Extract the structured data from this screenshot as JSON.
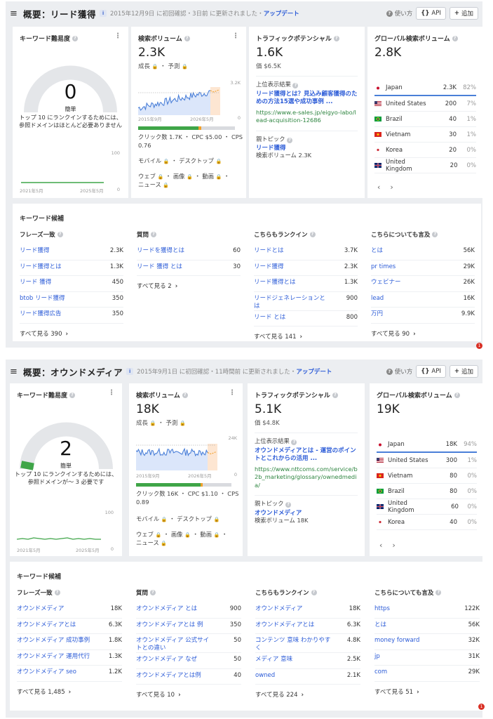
{
  "panels": [
    {
      "title": "概要：リード獲得",
      "info": "i",
      "meta": "2015年12月9日 に初回確認・3日前 に更新されました・",
      "update": "アップデート",
      "howto": "使い方",
      "api": "API",
      "add": "追加",
      "difficulty": {
        "title": "キーワード難易度",
        "value": "0",
        "level": "簡単",
        "desc": "トップ 10 にランクインするためには、参照ドメインはほとんど必要ありません",
        "axis_max": "100",
        "axis_min": "0",
        "date_start": "2021年5月",
        "date_end": "2025年5月",
        "gauge_fraction": 0.0
      },
      "volume": {
        "title": "検索ボリューム",
        "value": "2.3K",
        "growth": "成長",
        "forecast": "予測",
        "chart_max": "3.2K",
        "chart_min": "0",
        "date_start": "2015年9月",
        "date_end": "2026年5月",
        "clicks_label": "クリック数",
        "clicks": "1.7K",
        "cpc_label": "CPC",
        "cpc": "$5.00",
        "cps_label": "CPS",
        "cps": "0.76",
        "mobile": "モバイル",
        "desktop": "デスクトップ",
        "web": "ウェブ",
        "image": "画像",
        "video": "動画",
        "news": "ニュース",
        "click_share": 0.62,
        "paid_share": 0.03
      },
      "traffic": {
        "title": "トラフィックポテンシャル",
        "value": "1.6K",
        "worth": "価 $6.5K",
        "top_label": "上位表示結果",
        "top_title": "リード獲得とは？見込み顧客獲得のための方法15選や成功事例 ...",
        "top_url": "https://www.e-sales.jp/eigyo-labo/lead-acquisition-12686",
        "parent_label": "親トピック",
        "parent_topic": "リード獲得",
        "parent_volume": "検索ボリューム 2.3K"
      },
      "global": {
        "title": "グローバル検索ボリューム",
        "value": "2.8K",
        "countries": [
          {
            "name": "Japan",
            "vol": "2.3K",
            "pct": "82%",
            "flag": "jp"
          },
          {
            "name": "United States",
            "vol": "200",
            "pct": "7%",
            "flag": "us"
          },
          {
            "name": "Brazil",
            "vol": "40",
            "pct": "1%",
            "flag": "br"
          },
          {
            "name": "Vietnam",
            "vol": "30",
            "pct": "1%",
            "flag": "vn"
          },
          {
            "name": "Korea",
            "vol": "20",
            "pct": "0%",
            "flag": "kr"
          },
          {
            "name": "United Kingdom",
            "vol": "20",
            "pct": "0%",
            "flag": "gb"
          }
        ]
      },
      "ideas": {
        "title": "キーワード候補",
        "columns": [
          {
            "title": "フレーズ一致",
            "rows": [
              {
                "k": "リード獲得",
                "v": "2.3K"
              },
              {
                "k": "リード獲得とは",
                "v": "1.3K"
              },
              {
                "k": "リード 獲得",
                "v": "450"
              },
              {
                "k": "btob リード獲得",
                "v": "350"
              },
              {
                "k": "リード獲得広告",
                "v": "350"
              }
            ],
            "see_all": "すべて見る 390"
          },
          {
            "title": "質問",
            "rows": [
              {
                "k": "リードを獲得とは",
                "v": "60"
              },
              {
                "k": "リード 獲得 とは",
                "v": "30"
              }
            ],
            "see_all": "すべて見る 2"
          },
          {
            "title": "こちらもランクイン",
            "rows": [
              {
                "k": "リードとは",
                "v": "3.7K"
              },
              {
                "k": "リード獲得",
                "v": "2.3K"
              },
              {
                "k": "リード獲得とは",
                "v": "1.3K"
              },
              {
                "k": "リードジェネレーションとは",
                "v": "900"
              },
              {
                "k": "リード とは",
                "v": "800"
              }
            ],
            "see_all": "すべて見る 141"
          },
          {
            "title": "こちらについても言及",
            "rows": [
              {
                "k": "とは",
                "v": "56K"
              },
              {
                "k": "pr times",
                "v": "29K"
              },
              {
                "k": "ウェビナー",
                "v": "26K"
              },
              {
                "k": "lead",
                "v": "16K"
              },
              {
                "k": "万円",
                "v": "9.9K"
              }
            ],
            "see_all": "すべて見る 90"
          }
        ]
      },
      "badge": "1"
    },
    {
      "title": "概要：オウンドメディア",
      "info": "i",
      "meta": "2015年9月1日 に初回確認・11時間前 に更新されました・",
      "update": "アップデート",
      "howto": "使い方",
      "api": "API",
      "add": "追加",
      "difficulty": {
        "title": "キーワード難易度",
        "value": "2",
        "level": "簡単",
        "desc": "トップ 10 にランクインするためには、参照ドメインが～ 3 必要です",
        "axis_max": "100",
        "axis_min": "0",
        "date_start": "2021年5月",
        "date_end": "2025年5月",
        "gauge_fraction": 0.02
      },
      "volume": {
        "title": "検索ボリューム",
        "value": "18K",
        "growth": "成長",
        "forecast": "予測",
        "chart_max": "24K",
        "chart_min": "0",
        "date_start": "2015年9月",
        "date_end": "2026年5月",
        "clicks_label": "クリック数",
        "clicks": "16K",
        "cpc_label": "CPC",
        "cpc": "$1.10",
        "cps_label": "CPS",
        "cps": "0.89",
        "mobile": "モバイル",
        "desktop": "デスクトップ",
        "web": "ウェブ",
        "image": "画像",
        "video": "動画",
        "news": "ニュース",
        "click_share": 0.68,
        "paid_share": 0.02
      },
      "traffic": {
        "title": "トラフィックポテンシャル",
        "value": "5.1K",
        "worth": "価 $4.8K",
        "top_label": "上位表示結果",
        "top_title": "オウンドメディアとは - 運営のポイントとこれからの活用 ...",
        "top_url": "https://www.nttcoms.com/service/b2b_marketing/glossary/ownedmedia/",
        "parent_label": "親トピック",
        "parent_topic": "オウンドメディア",
        "parent_volume": "検索ボリューム 18K"
      },
      "global": {
        "title": "グローバル検索ボリューム",
        "value": "19K",
        "countries": [
          {
            "name": "Japan",
            "vol": "18K",
            "pct": "94%",
            "flag": "jp"
          },
          {
            "name": "United States",
            "vol": "300",
            "pct": "1%",
            "flag": "us"
          },
          {
            "name": "Vietnam",
            "vol": "80",
            "pct": "0%",
            "flag": "vn"
          },
          {
            "name": "Brazil",
            "vol": "80",
            "pct": "0%",
            "flag": "br"
          },
          {
            "name": "United Kingdom",
            "vol": "60",
            "pct": "0%",
            "flag": "gb"
          },
          {
            "name": "Korea",
            "vol": "40",
            "pct": "0%",
            "flag": "kr"
          }
        ]
      },
      "ideas": {
        "title": "キーワード候補",
        "columns": [
          {
            "title": "フレーズ一致",
            "rows": [
              {
                "k": "オウンドメディア",
                "v": "18K"
              },
              {
                "k": "オウンドメディアとは",
                "v": "6.3K"
              },
              {
                "k": "オウンドメディア 成功事例",
                "v": "1.8K"
              },
              {
                "k": "オウンドメディア 運用代行",
                "v": "1.3K"
              },
              {
                "k": "オウンドメディア seo",
                "v": "1.2K"
              }
            ],
            "see_all": "すべて見る 1,485"
          },
          {
            "title": "質問",
            "rows": [
              {
                "k": "オウンドメディア とは",
                "v": "900"
              },
              {
                "k": "オウンドメディアとは 例",
                "v": "350"
              },
              {
                "k": "オウンドメディア 公式サイトとの違い",
                "v": "50"
              },
              {
                "k": "オウンドメディア なぜ",
                "v": "50"
              },
              {
                "k": "オウンドメディアとは例",
                "v": "40"
              }
            ],
            "see_all": "すべて見る 10"
          },
          {
            "title": "こちらもランクイン",
            "rows": [
              {
                "k": "オウンドメディア",
                "v": "18K"
              },
              {
                "k": "オウンドメディアとは",
                "v": "6.3K"
              },
              {
                "k": "コンテンツ 意味 わかりやすく",
                "v": "4.8K"
              },
              {
                "k": "メディア 意味",
                "v": "2.5K"
              },
              {
                "k": "owned",
                "v": "2.1K"
              }
            ],
            "see_all": "すべて見る 224"
          },
          {
            "title": "こちらについても言及",
            "rows": [
              {
                "k": "https",
                "v": "122K"
              },
              {
                "k": "とは",
                "v": "56K"
              },
              {
                "k": "money forward",
                "v": "32K"
              },
              {
                "k": "jp",
                "v": "31K"
              },
              {
                "k": "com",
                "v": "29K"
              }
            ],
            "see_all": "すべて見る 51"
          }
        ]
      },
      "badge": "1"
    }
  ],
  "icons": {
    "menu": "≡",
    "question": "?",
    "more": "⋮",
    "lock": "🔒",
    "prev": "‹",
    "next": "›",
    "see_all_arrow": "›",
    "api": "{}",
    "plus": "+"
  },
  "colors": {
    "link": "#2b5bd7",
    "green": "#3fa548",
    "orange": "#f1a02a",
    "gauge_track": "#e4e6e9",
    "chart_line": "#4a7fd8",
    "chart_fill": "#dbe6fa"
  }
}
